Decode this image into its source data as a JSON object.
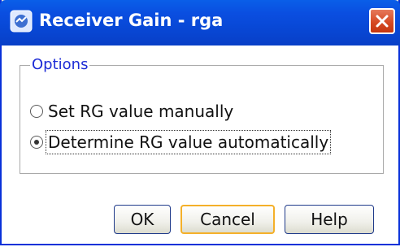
{
  "window": {
    "title": "Receiver Gain - rga"
  },
  "options": {
    "legend": "Options",
    "radios": [
      {
        "label": "Set RG value manually",
        "checked": false
      },
      {
        "label": "Determine RG value automatically",
        "checked": true
      }
    ]
  },
  "buttons": {
    "ok": "OK",
    "cancel": "Cancel",
    "help": "Help"
  },
  "icons": {
    "app": "app-icon",
    "close": "close-icon"
  }
}
